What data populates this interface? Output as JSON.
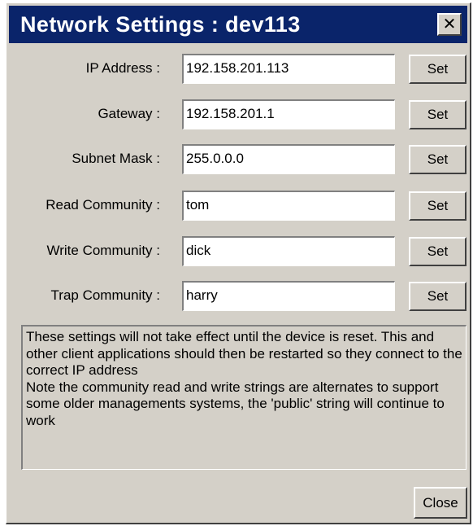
{
  "window": {
    "title": "Network Settings : dev113",
    "close_glyph": "✕"
  },
  "fields": [
    {
      "label": "IP Address :",
      "value": "192.158.201.113",
      "button": "Set"
    },
    {
      "label": "Gateway :",
      "value": "192.158.201.1",
      "button": "Set"
    },
    {
      "label": "Subnet Mask :",
      "value": "255.0.0.0",
      "button": "Set"
    },
    {
      "label": "Read Community :",
      "value": "tom",
      "button": "Set"
    },
    {
      "label": "Write Community :",
      "value": "dick",
      "button": "Set"
    },
    {
      "label": "Trap Community :",
      "value": "harry",
      "button": "Set"
    }
  ],
  "notes": {
    "para1": "These settings will not take effect until the device is reset. This and other client applications should then be restarted so they connect to the correct IP address",
    "para2": "Note the community read and write strings are alternates to support some older managements systems, the 'public' string will continue to work"
  },
  "footer": {
    "close_label": "Close"
  }
}
